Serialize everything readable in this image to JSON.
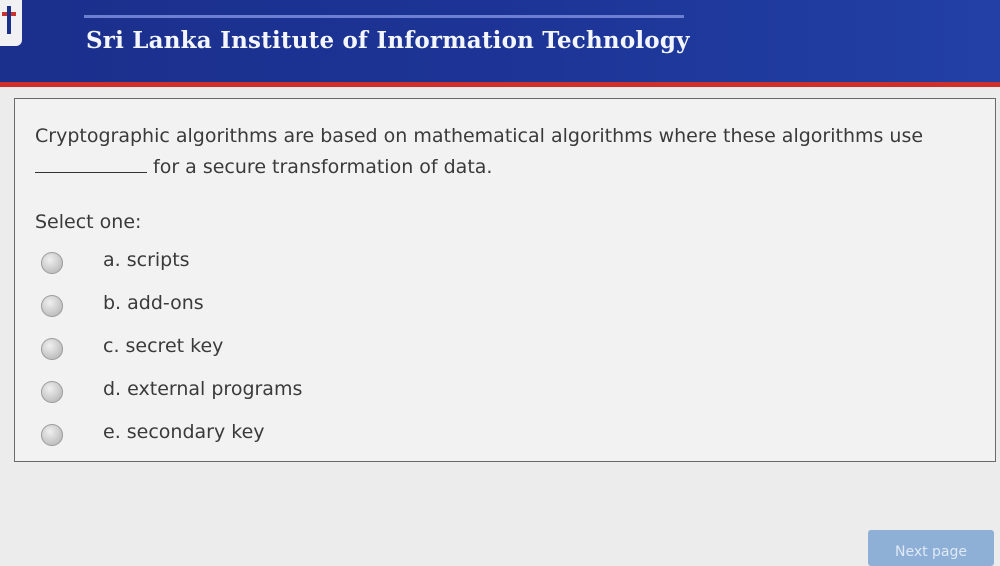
{
  "header": {
    "institute_name": "Sri Lanka Institute of Information Technology"
  },
  "question": {
    "text": "for a secure transformation of data.",
    "text_lead": "Cryptographic algorithms are based on mathematical algorithms where these algorithms use",
    "select_label": "Select one:",
    "options": [
      {
        "label": "a. scripts",
        "selected": false
      },
      {
        "label": "b. add-ons",
        "selected": false
      },
      {
        "label": "c. secret key",
        "selected": false
      },
      {
        "label": "d. external programs",
        "selected": false
      },
      {
        "label": "e. secondary key",
        "selected": false
      }
    ]
  },
  "footer": {
    "next_label": "Next page"
  },
  "colors": {
    "header_bg": "#1d3597",
    "header_accent": "#d0302a",
    "button_bg": "#8fb0d6"
  }
}
